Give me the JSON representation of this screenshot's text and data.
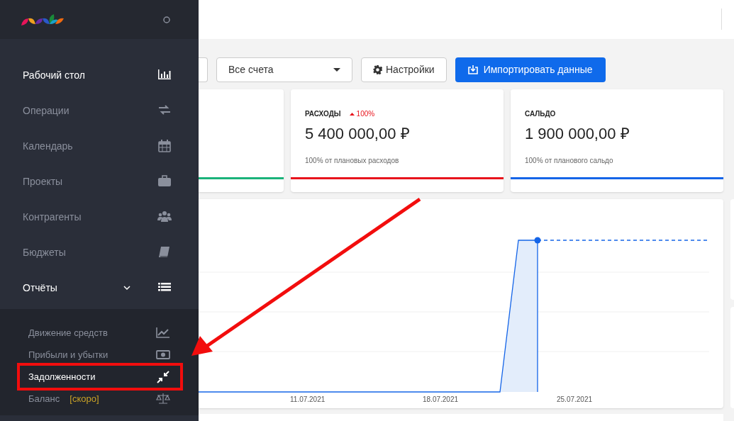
{
  "sidebar": {
    "items": [
      {
        "label": "Рабочий стол",
        "selected": true
      },
      {
        "label": "Операции",
        "selected": false
      },
      {
        "label": "Календарь",
        "selected": false
      },
      {
        "label": "Проекты",
        "selected": false
      },
      {
        "label": "Контрагенты",
        "selected": false
      },
      {
        "label": "Бюджеты",
        "selected": false
      },
      {
        "label": "Отчёты",
        "expanded": true,
        "children": [
          {
            "label": "Движение средств",
            "selected": false
          },
          {
            "label": "Прибыли и убытки",
            "selected": false
          },
          {
            "label": "Задолженности",
            "selected": true,
            "highlighted": true
          },
          {
            "label": "Баланс",
            "selected": false,
            "badge": "[скоро]"
          }
        ]
      }
    ]
  },
  "toolbar": {
    "account_select": {
      "value": "Все счета"
    },
    "settings_button": "Настройки",
    "import_button": "Импортировать данные"
  },
  "cards": [
    {
      "color": "#1bb37a"
    },
    {
      "title": "РАСХОДЫ",
      "trend": "100%",
      "amount": "5 400 000,00 ₽",
      "note": "100% от плановых расходов",
      "color": "#e8141c"
    },
    {
      "title": "САЛЬДО",
      "amount": "1 900 000,00 ₽",
      "note": "100% от планового сальдо",
      "color": "#1565e8"
    }
  ],
  "chart": {
    "x_labels": [
      "11.07.2021",
      "18.07.2021",
      "25.07.2021"
    ]
  }
}
